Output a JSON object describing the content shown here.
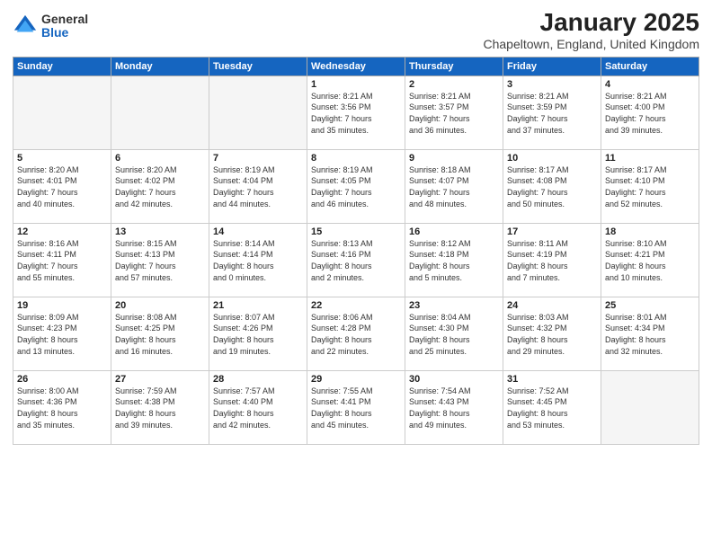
{
  "header": {
    "logo_general": "General",
    "logo_blue": "Blue",
    "title": "January 2025",
    "location": "Chapeltown, England, United Kingdom"
  },
  "days_of_week": [
    "Sunday",
    "Monday",
    "Tuesday",
    "Wednesday",
    "Thursday",
    "Friday",
    "Saturday"
  ],
  "weeks": [
    [
      {
        "day": "",
        "info": ""
      },
      {
        "day": "",
        "info": ""
      },
      {
        "day": "",
        "info": ""
      },
      {
        "day": "1",
        "info": "Sunrise: 8:21 AM\nSunset: 3:56 PM\nDaylight: 7 hours\nand 35 minutes."
      },
      {
        "day": "2",
        "info": "Sunrise: 8:21 AM\nSunset: 3:57 PM\nDaylight: 7 hours\nand 36 minutes."
      },
      {
        "day": "3",
        "info": "Sunrise: 8:21 AM\nSunset: 3:59 PM\nDaylight: 7 hours\nand 37 minutes."
      },
      {
        "day": "4",
        "info": "Sunrise: 8:21 AM\nSunset: 4:00 PM\nDaylight: 7 hours\nand 39 minutes."
      }
    ],
    [
      {
        "day": "5",
        "info": "Sunrise: 8:20 AM\nSunset: 4:01 PM\nDaylight: 7 hours\nand 40 minutes."
      },
      {
        "day": "6",
        "info": "Sunrise: 8:20 AM\nSunset: 4:02 PM\nDaylight: 7 hours\nand 42 minutes."
      },
      {
        "day": "7",
        "info": "Sunrise: 8:19 AM\nSunset: 4:04 PM\nDaylight: 7 hours\nand 44 minutes."
      },
      {
        "day": "8",
        "info": "Sunrise: 8:19 AM\nSunset: 4:05 PM\nDaylight: 7 hours\nand 46 minutes."
      },
      {
        "day": "9",
        "info": "Sunrise: 8:18 AM\nSunset: 4:07 PM\nDaylight: 7 hours\nand 48 minutes."
      },
      {
        "day": "10",
        "info": "Sunrise: 8:17 AM\nSunset: 4:08 PM\nDaylight: 7 hours\nand 50 minutes."
      },
      {
        "day": "11",
        "info": "Sunrise: 8:17 AM\nSunset: 4:10 PM\nDaylight: 7 hours\nand 52 minutes."
      }
    ],
    [
      {
        "day": "12",
        "info": "Sunrise: 8:16 AM\nSunset: 4:11 PM\nDaylight: 7 hours\nand 55 minutes."
      },
      {
        "day": "13",
        "info": "Sunrise: 8:15 AM\nSunset: 4:13 PM\nDaylight: 7 hours\nand 57 minutes."
      },
      {
        "day": "14",
        "info": "Sunrise: 8:14 AM\nSunset: 4:14 PM\nDaylight: 8 hours\nand 0 minutes."
      },
      {
        "day": "15",
        "info": "Sunrise: 8:13 AM\nSunset: 4:16 PM\nDaylight: 8 hours\nand 2 minutes."
      },
      {
        "day": "16",
        "info": "Sunrise: 8:12 AM\nSunset: 4:18 PM\nDaylight: 8 hours\nand 5 minutes."
      },
      {
        "day": "17",
        "info": "Sunrise: 8:11 AM\nSunset: 4:19 PM\nDaylight: 8 hours\nand 7 minutes."
      },
      {
        "day": "18",
        "info": "Sunrise: 8:10 AM\nSunset: 4:21 PM\nDaylight: 8 hours\nand 10 minutes."
      }
    ],
    [
      {
        "day": "19",
        "info": "Sunrise: 8:09 AM\nSunset: 4:23 PM\nDaylight: 8 hours\nand 13 minutes."
      },
      {
        "day": "20",
        "info": "Sunrise: 8:08 AM\nSunset: 4:25 PM\nDaylight: 8 hours\nand 16 minutes."
      },
      {
        "day": "21",
        "info": "Sunrise: 8:07 AM\nSunset: 4:26 PM\nDaylight: 8 hours\nand 19 minutes."
      },
      {
        "day": "22",
        "info": "Sunrise: 8:06 AM\nSunset: 4:28 PM\nDaylight: 8 hours\nand 22 minutes."
      },
      {
        "day": "23",
        "info": "Sunrise: 8:04 AM\nSunset: 4:30 PM\nDaylight: 8 hours\nand 25 minutes."
      },
      {
        "day": "24",
        "info": "Sunrise: 8:03 AM\nSunset: 4:32 PM\nDaylight: 8 hours\nand 29 minutes."
      },
      {
        "day": "25",
        "info": "Sunrise: 8:01 AM\nSunset: 4:34 PM\nDaylight: 8 hours\nand 32 minutes."
      }
    ],
    [
      {
        "day": "26",
        "info": "Sunrise: 8:00 AM\nSunset: 4:36 PM\nDaylight: 8 hours\nand 35 minutes."
      },
      {
        "day": "27",
        "info": "Sunrise: 7:59 AM\nSunset: 4:38 PM\nDaylight: 8 hours\nand 39 minutes."
      },
      {
        "day": "28",
        "info": "Sunrise: 7:57 AM\nSunset: 4:40 PM\nDaylight: 8 hours\nand 42 minutes."
      },
      {
        "day": "29",
        "info": "Sunrise: 7:55 AM\nSunset: 4:41 PM\nDaylight: 8 hours\nand 45 minutes."
      },
      {
        "day": "30",
        "info": "Sunrise: 7:54 AM\nSunset: 4:43 PM\nDaylight: 8 hours\nand 49 minutes."
      },
      {
        "day": "31",
        "info": "Sunrise: 7:52 AM\nSunset: 4:45 PM\nDaylight: 8 hours\nand 53 minutes."
      },
      {
        "day": "",
        "info": ""
      }
    ]
  ]
}
